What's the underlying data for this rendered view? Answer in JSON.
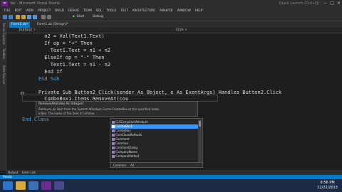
{
  "window": {
    "title": "Ver - Microsoft Visual Studio",
    "account": "Quick Launch (Ctrl+Q)",
    "btn_min": "−",
    "btn_max": "□",
    "btn_close": "✕"
  },
  "menu": [
    "FILE",
    "EDIT",
    "VIEW",
    "PROJECT",
    "BUILD",
    "DEBUG",
    "TEAM",
    "SQL",
    "TOOLS",
    "TEST",
    "ARCHITECTURE",
    "ANALYZE",
    "WINDOW",
    "HELP"
  ],
  "toolbar": {
    "start_label": "Start",
    "config": "Debug"
  },
  "left_strip": [
    "Server Explorer",
    "Toolbox",
    "Data Sources"
  ],
  "tabs": [
    {
      "label": "Form1.vb*",
      "active": true
    },
    {
      "label": "Form1.vb [Design]*",
      "active": false
    }
  ],
  "nav": {
    "left": "Button2",
    "right": "Click"
  },
  "code": {
    "lines": [
      {
        "text": "      n2 = Val(Text1.Text)"
      },
      {
        "text": "      If op = \"+\" Then"
      },
      {
        "text": "        Text1.Text = n1 + n2"
      },
      {
        "text": "      ElseIf op = \"-\" Then"
      },
      {
        "text": "        Text1.Text = n1 - n2"
      },
      {
        "text": "      End If"
      },
      {
        "text": "    End Sub"
      },
      {
        "text": ""
      },
      {
        "text": "    Private Sub Button2_Click(sender As Object, e As EventArgs) Handles Button2.Click"
      },
      {
        "text": "      ComboBox1.Items.RemoveAt(cou"
      },
      {
        "text": "    E"
      },
      {
        "text": "End Class"
      }
    ]
  },
  "intellisense": {
    "signature": "RemoveAt(index As Integer)",
    "description": "Removes an item from the System.Windows.Forms.ComboBox at the specified index.",
    "param": "index: The index of the item to remove.",
    "items": [
      "CLSCompliantAttribute",
      "ComboBox1",
      "ComboBox",
      "ComCloseMethods",
      "Comment",
      "Common",
      "CommonDialog",
      "CompanyName",
      "CompareMethod"
    ],
    "selected_index": 1,
    "footer_common": "Common",
    "footer_all": "All"
  },
  "bottom_tabs": [
    "Output",
    "Error List"
  ],
  "status": {
    "text": "Ready"
  },
  "taskbar": {
    "time": "8:56 PM",
    "date": "12/22/2013"
  }
}
